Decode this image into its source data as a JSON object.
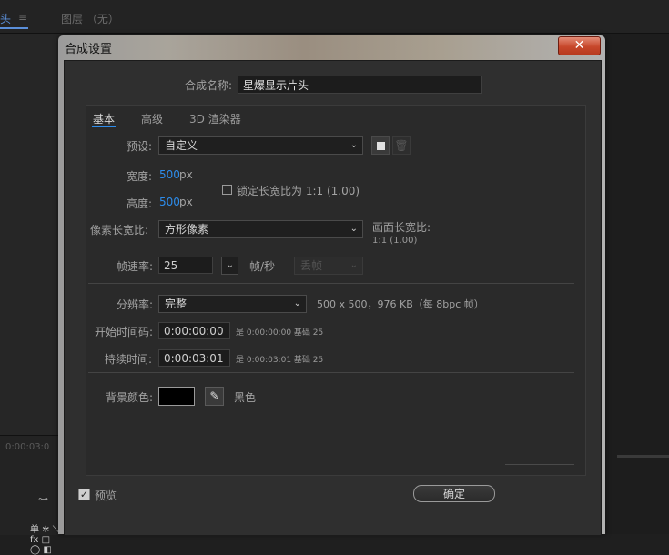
{
  "background": {
    "tab_left": "头",
    "tab_menu": "≡",
    "tab_layer": "图层 （无）",
    "timecode": "0:00:03:0"
  },
  "dialog": {
    "title": "合成设置",
    "close": "✕",
    "comp_name_label": "合成名称:",
    "comp_name_value": "星爆显示片头",
    "tabs": [
      "基本",
      "高级",
      "3D 渲染器"
    ],
    "preset_label": "预设:",
    "preset_value": "自定义",
    "width_label": "宽度:",
    "width_value": "500",
    "width_unit": "px",
    "height_label": "高度:",
    "height_value": "500",
    "height_unit": "px",
    "lock_ratio_label": "锁定长宽比为 1:1 (1.00)",
    "pixel_aspect_label": "像素长宽比:",
    "pixel_aspect_value": "方形像素",
    "frame_aspect_label": "画面长宽比:",
    "frame_aspect_value": "1:1 (1.00)",
    "frame_rate_label": "帧速率:",
    "frame_rate_value": "25",
    "frame_rate_unit": "帧/秒",
    "drop_frame_value": "丢帧",
    "resolution_label": "分辨率:",
    "resolution_value": "完整",
    "resolution_info": "500 x 500，976 KB（每 8bpc 帧）",
    "start_tc_label": "开始时间码:",
    "start_tc_value": "0:00:00:00",
    "start_tc_note": "是 0:00:00:00  基础 25",
    "duration_label": "持续时间:",
    "duration_value": "0:00:03:01",
    "duration_note": "是 0:00:03:01  基础 25",
    "bg_color_label": "背景颜色:",
    "bg_color_name": "黑色",
    "bg_color_hex": "#000000",
    "preview_label": "预览",
    "ok_label": "确定"
  }
}
